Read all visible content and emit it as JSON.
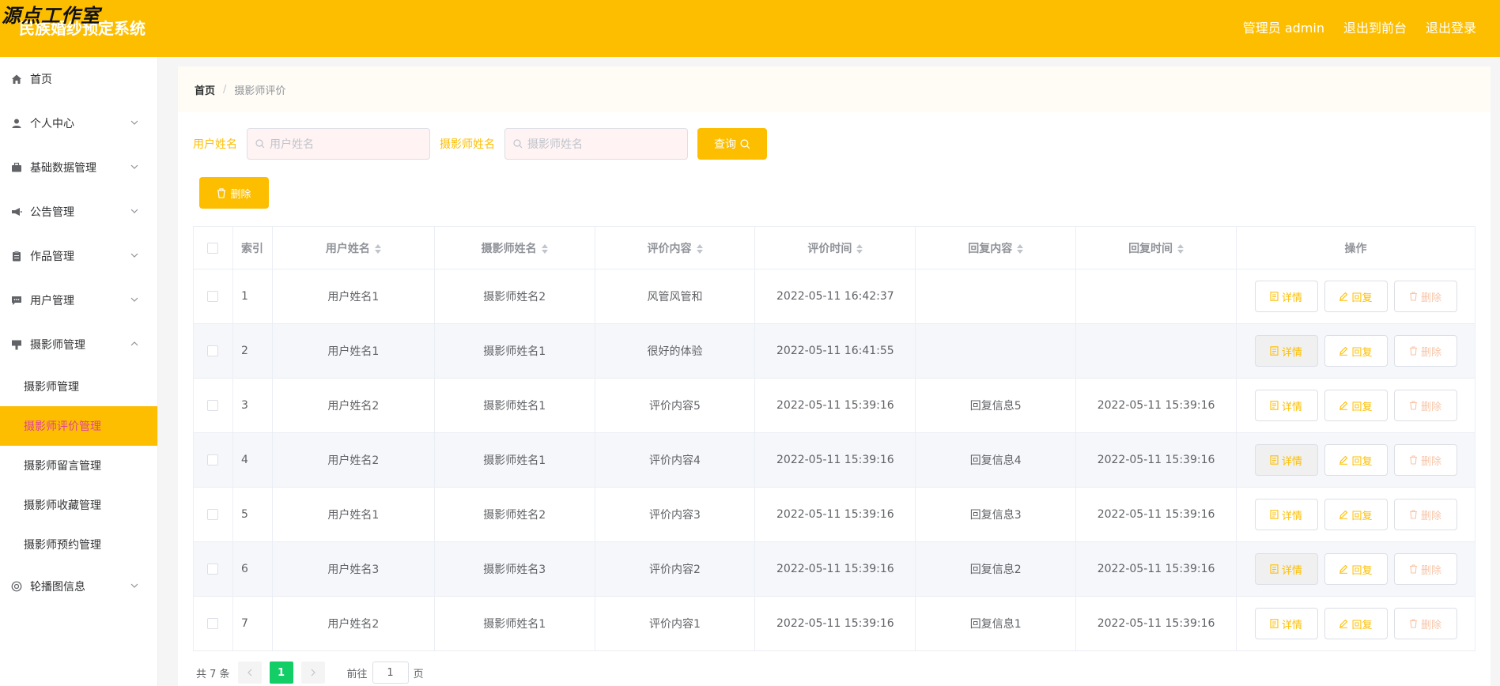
{
  "header": {
    "watermark": "源点工作室",
    "title": "民族婚纱预定系统",
    "admin_label": "管理员 admin",
    "to_front_label": "退出到前台",
    "logout_label": "退出登录"
  },
  "sidebar": {
    "items": [
      {
        "label": "首页",
        "icon": "home-icon"
      },
      {
        "label": "个人中心",
        "icon": "user-icon"
      },
      {
        "label": "基础数据管理",
        "icon": "briefcase-icon"
      },
      {
        "label": "公告管理",
        "icon": "megaphone-icon"
      },
      {
        "label": "作品管理",
        "icon": "clipboard-icon"
      },
      {
        "label": "用户管理",
        "icon": "chat-icon"
      },
      {
        "label": "摄影师管理",
        "icon": "stamp-icon"
      }
    ],
    "sub_items": [
      {
        "label": "摄影师管理"
      },
      {
        "label": "摄影师评价管理"
      },
      {
        "label": "摄影师留言管理"
      },
      {
        "label": "摄影师收藏管理"
      },
      {
        "label": "摄影师预约管理"
      }
    ],
    "last_item": {
      "label": "轮播图信息",
      "icon": "carousel-icon"
    }
  },
  "breadcrumb": {
    "home": "首页",
    "separator": "/",
    "current": "摄影师评价"
  },
  "search": {
    "user_label": "用户姓名",
    "user_placeholder": "用户姓名",
    "photographer_label": "摄影师姓名",
    "photographer_placeholder": "摄影师姓名",
    "query_label": "查询"
  },
  "batch_delete_label": "删除",
  "table": {
    "headers": {
      "index": "索引",
      "user": "用户姓名",
      "photographer": "摄影师姓名",
      "content": "评价内容",
      "time": "评价时间",
      "reply": "回复内容",
      "reply_time": "回复时间",
      "ops": "操作"
    },
    "rows": [
      {
        "index": "1",
        "user": "用户姓名1",
        "photographer": "摄影师姓名2",
        "content": "风管风管和",
        "time": "2022-05-11 16:42:37",
        "reply": "",
        "reply_time": ""
      },
      {
        "index": "2",
        "user": "用户姓名1",
        "photographer": "摄影师姓名1",
        "content": "很好的体验",
        "time": "2022-05-11 16:41:55",
        "reply": "",
        "reply_time": ""
      },
      {
        "index": "3",
        "user": "用户姓名2",
        "photographer": "摄影师姓名1",
        "content": "评价内容5",
        "time": "2022-05-11 15:39:16",
        "reply": "回复信息5",
        "reply_time": "2022-05-11 15:39:16"
      },
      {
        "index": "4",
        "user": "用户姓名2",
        "photographer": "摄影师姓名1",
        "content": "评价内容4",
        "time": "2022-05-11 15:39:16",
        "reply": "回复信息4",
        "reply_time": "2022-05-11 15:39:16"
      },
      {
        "index": "5",
        "user": "用户姓名1",
        "photographer": "摄影师姓名2",
        "content": "评价内容3",
        "time": "2022-05-11 15:39:16",
        "reply": "回复信息3",
        "reply_time": "2022-05-11 15:39:16"
      },
      {
        "index": "6",
        "user": "用户姓名3",
        "photographer": "摄影师姓名3",
        "content": "评价内容2",
        "time": "2022-05-11 15:39:16",
        "reply": "回复信息2",
        "reply_time": "2022-05-11 15:39:16"
      },
      {
        "index": "7",
        "user": "用户姓名2",
        "photographer": "摄影师姓名1",
        "content": "评价内容1",
        "time": "2022-05-11 15:39:16",
        "reply": "回复信息1",
        "reply_time": "2022-05-11 15:39:16"
      }
    ],
    "op_labels": {
      "detail": "详情",
      "reply": "回复",
      "delete": "删除"
    }
  },
  "pagination": {
    "total_text": "共 7 条",
    "current_page": "1",
    "goto_prefix": "前往",
    "goto_value": "1",
    "goto_suffix": "页"
  },
  "colors": {
    "accent": "#fdbe00",
    "active_text": "#e0409d",
    "page_active": "#13ce66"
  }
}
